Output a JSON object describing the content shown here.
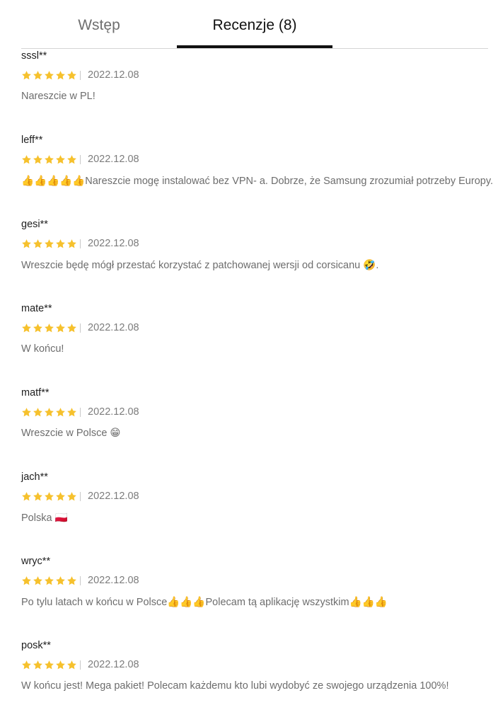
{
  "tabs": {
    "intro_label": "Wstęp",
    "reviews_label": "Recenzje (8)",
    "active": "reviews"
  },
  "colors": {
    "star": "#f6c12d",
    "active_tab_underline": "#111111"
  },
  "reviews": [
    {
      "user": "sssl**",
      "rating": 5,
      "date": "2022.12.08",
      "text": "Nareszcie w PL!"
    },
    {
      "user": "leff**",
      "rating": 5,
      "date": "2022.12.08",
      "text": "👍👍👍👍👍Nareszcie mogę instalować bez VPN- a. Dobrze, że Samsung zrozumiał potrzeby Europy."
    },
    {
      "user": "gesi**",
      "rating": 5,
      "date": "2022.12.08",
      "text": "Wreszcie będę mógł przestać korzystać z patchowanej wersji od corsicanu 🤣."
    },
    {
      "user": "mate**",
      "rating": 5,
      "date": "2022.12.08",
      "text": "W końcu!"
    },
    {
      "user": "matf**",
      "rating": 5,
      "date": "2022.12.08",
      "text": "Wreszcie w Polsce 😁"
    },
    {
      "user": "jach**",
      "rating": 5,
      "date": "2022.12.08",
      "text": "Polska 🇵🇱"
    },
    {
      "user": "wryc**",
      "rating": 5,
      "date": "2022.12.08",
      "text": "Po tylu latach w końcu w Polsce👍👍👍Polecam tą aplikację wszystkim👍👍👍"
    },
    {
      "user": "posk**",
      "rating": 5,
      "date": "2022.12.08",
      "text": "W końcu jest! Mega pakiet! Polecam każdemu kto lubi wydobyć ze swojego urządzenia 100%!"
    }
  ]
}
